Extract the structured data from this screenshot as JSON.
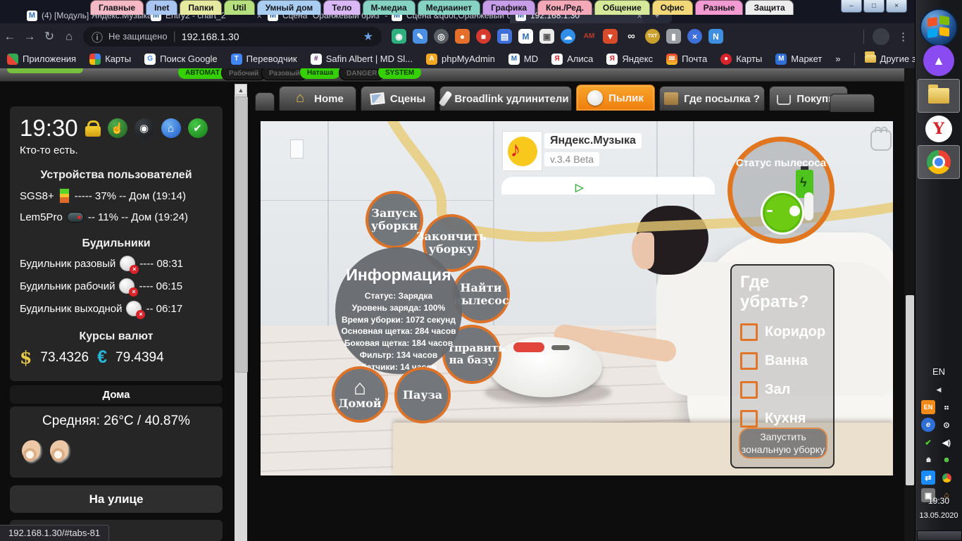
{
  "colors": {
    "accent_orange": "#f08a19",
    "circle_border": "#dd7328",
    "badge_green": "#35d000",
    "yellow_line": "#e7cb74"
  },
  "glyphs": {
    "back": "←",
    "forward": "→",
    "reload": "↻",
    "home": "⌂",
    "info": "ⓘ",
    "star": "★",
    "menu": "⋮",
    "close": "×",
    "min": "–",
    "max": "□",
    "new_tab": "+",
    "up": "▲",
    "tray_arrow": "◀",
    "play": "▷",
    "check": "✔",
    "hand": "☝",
    "sensor": "◉",
    "house": "⌂",
    "close_small": "×",
    "dollar": "$",
    "euro": "€",
    "lightning": "ϟ",
    "note": "♪"
  },
  "folder_tabs": [
    {
      "label": "Главные",
      "color": "#f4b9c4"
    },
    {
      "label": "Inet",
      "color": "#a9c6f2"
    },
    {
      "label": "Папки",
      "color": "#e6e9a0"
    },
    {
      "label": "Util",
      "color": "#b5e07d"
    },
    {
      "label": "Умный дом",
      "color": "#aacdf2"
    },
    {
      "label": "Тело",
      "color": "#d9b8f5"
    },
    {
      "label": "М-медиа",
      "color": "#86d3c3"
    },
    {
      "label": "Медиаинет",
      "color": "#86d3c3"
    },
    {
      "label": "Графика",
      "color": "#c79ce8"
    },
    {
      "label": "Кон./Ред.",
      "color": "#f4a9b8"
    },
    {
      "label": "Общение",
      "color": "#d6e89a"
    },
    {
      "label": "Офис",
      "color": "#f2d878"
    },
    {
      "label": "Разные",
      "color": "#f29ad2"
    },
    {
      "label": "Защита",
      "color": "#ededed"
    }
  ],
  "browser": {
    "tabs": [
      {
        "title": "(4) [Модуль] Яндекс.Музыка"
      },
      {
        "title": "Entry2 - chart_2"
      },
      {
        "title": "Сцена \"Оранжевый бриз\" -"
      },
      {
        "title": "Сцена &quot;Оранжевый бр"
      },
      {
        "title": "192.168.1.30"
      }
    ],
    "security": "Не защищено",
    "url": "192.168.1.30",
    "bookmarks": {
      "apps": "Приложения",
      "items": [
        "Карты",
        "Поиск Google",
        "Переводчик",
        "Safin Albert | MD Sl...",
        "phpMyAdmin",
        "MD",
        "Алиса",
        "Яндекс",
        "Почта",
        "Карты",
        "Маркет",
        "»",
        "Другие закладки"
      ]
    },
    "status_link": "192.168.1.30/#tabs-81"
  },
  "page": {
    "mode_badges": [
      {
        "label": "АВТОМАТ",
        "on": true
      },
      {
        "label": "Рабочий",
        "on": false
      },
      {
        "label": "Разовый",
        "on": false
      },
      {
        "label": "Наташа",
        "on": true
      },
      {
        "label": "DANGER",
        "on": false
      },
      {
        "label": "SYSTEM",
        "on": true
      }
    ],
    "sidebar": {
      "time": "19:30",
      "presence": "Кто-то есть.",
      "devices_title": "Устройства пользователей",
      "devices": [
        {
          "name": "SGS8+",
          "info": "----- 37% -- Дом (19:14)"
        },
        {
          "name": "Lem5Pro",
          "info": "-- 11% -- Дом (19:24)"
        }
      ],
      "alarms_title": "Будильники",
      "alarms": [
        {
          "name": "Будильник разовый",
          "time": "---- 08:31"
        },
        {
          "name": "Будильник рабочий",
          "time": "---- 06:15"
        },
        {
          "name": "Будильник выходной",
          "time": "-- 06:17"
        }
      ],
      "currency_title": "Курсы валют",
      "usd": "73.4326",
      "eur": "79.4394",
      "home_title": "Дома",
      "average": "Средняя: 26°C / 40.87%",
      "outside_button": "На улице"
    },
    "tabs": [
      {
        "label": "«"
      },
      {
        "label": "Home"
      },
      {
        "label": "Сцены"
      },
      {
        "label": "Broadlink удлинители"
      },
      {
        "label": "Пылик",
        "active": true
      },
      {
        "label": "Где посылка ?"
      },
      {
        "label": "Покупки"
      },
      {
        "label": "»"
      }
    ],
    "music_widget": {
      "app": "Яндекс.Музыка",
      "version": "v.3.4 Beta"
    },
    "vacuum": {
      "status_label": "Статус пылесоса",
      "btn_start": "Запуск уборки",
      "btn_finish": "Закончить уборку",
      "btn_find": "Найти пылесос",
      "btn_dock": "Отправить на базу",
      "btn_home": "Домой",
      "btn_pause": "Пауза",
      "info_title": "Информация",
      "info_lines": [
        "Статус: Зарядка",
        "Уровень заряда: 100%",
        "Время уборки: 1072 секунд",
        "Основная щетка: 284 часов",
        "Боковая щетка: 184 часов",
        "Фильтр: 134 часов",
        "Датчики: 14 часов"
      ],
      "zones_title": "Где убрать?",
      "zones": [
        "Коридор",
        "Ванна",
        "Зал",
        "Кухня"
      ],
      "zone_button": "Запустить зональную уборку"
    }
  },
  "taskbar": {
    "lang_floating": "EN",
    "tray_lang": "EN",
    "time": "19:30",
    "date": "13.05.2020"
  }
}
